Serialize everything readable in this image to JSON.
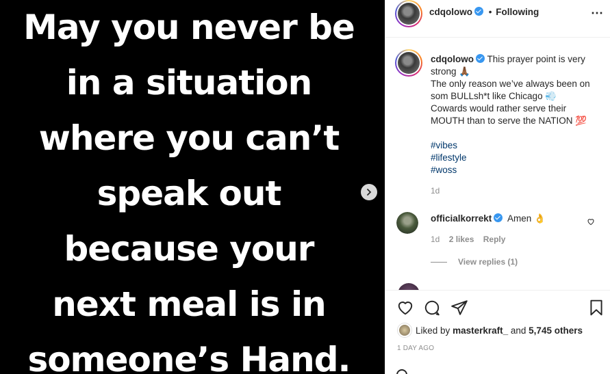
{
  "post": {
    "image_lines": [
      "May you never be",
      "in a situation",
      "where you can’t",
      "speak out",
      "because your",
      "next meal is in",
      "someone’s Hand."
    ],
    "next_icon": "chevron-right-icon"
  },
  "header": {
    "username": "cdqolowo",
    "separator": "•",
    "follow_status": "Following",
    "more_icon": "more-horizontal-icon"
  },
  "caption": {
    "username": "cdqolowo",
    "lines": [
      "This prayer point is very",
      "strong 🙏🏾",
      "The only reason we’ve always been on",
      "som BULLsh*t like Chicago 💨",
      "Cowards would rather serve their",
      "MOUTH than to serve the NATION 💯"
    ],
    "hashtags": [
      "#vibes",
      "#lifestyle",
      "#woss"
    ],
    "time": "1d"
  },
  "comment": {
    "username": "officialkorrekt",
    "text": "Amen 👌",
    "time": "1d",
    "likes": "2 likes",
    "reply": "Reply",
    "view_replies": "View replies (1)"
  },
  "actions": {
    "like_icon": "heart-icon",
    "comment_icon": "comment-icon",
    "share_icon": "paper-plane-icon",
    "save_icon": "bookmark-icon"
  },
  "likes_summary": {
    "prefix": "Liked by",
    "user": "masterkraft_",
    "middle": "and",
    "count": "5,745 others"
  },
  "post_date": "1 DAY AGO"
}
